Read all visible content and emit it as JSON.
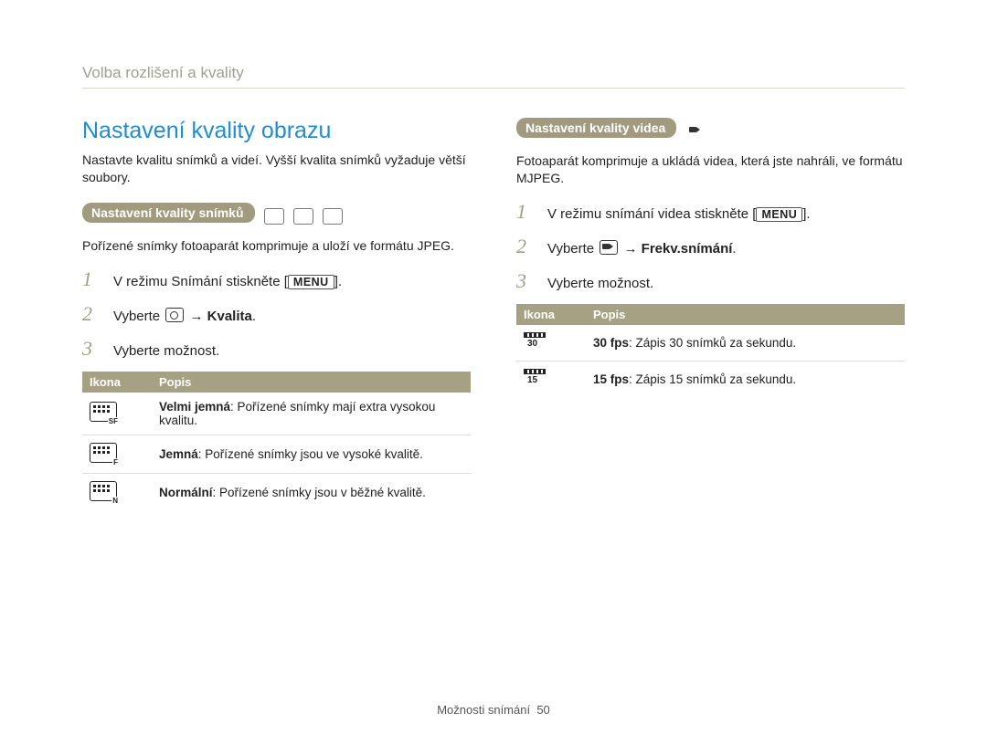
{
  "breadcrumb": "Volba rozlišení a kvality",
  "left": {
    "title": "Nastavení kvality obrazu",
    "intro": "Nastavte kvalitu snímků a videí. Vyšší kvalita snímků vyžaduje větší soubory.",
    "pill": "Nastavení kvality snímků",
    "sub": "Pořízené snímky fotoaparát komprimuje a uloží ve formátu JPEG.",
    "steps": {
      "s1_a": "V režimu Snímání stiskněte [",
      "s1_btn": "MENU",
      "s1_b": "].",
      "s2_a": "Vyberte ",
      "s2_arrow": " → ",
      "s2_bold": "Kvalita",
      "s2_b": ".",
      "s3": "Vyberte možnost."
    },
    "table": {
      "h1": "Ikona",
      "h2": "Popis",
      "rows": [
        {
          "icon_sub": "SF",
          "bold": "Velmi jemná",
          "text": ": Pořízené snímky mají extra vysokou kvalitu."
        },
        {
          "icon_sub": "F",
          "bold": "Jemná",
          "text": ": Pořízené snímky jsou ve vysoké kvalitě."
        },
        {
          "icon_sub": "N",
          "bold": "Normální",
          "text": ": Pořízené snímky jsou v běžné kvalitě."
        }
      ]
    }
  },
  "right": {
    "pill": "Nastavení kvality videa",
    "sub": "Fotoaparát komprimuje a ukládá videa, která jste nahráli, ve formátu MJPEG.",
    "steps": {
      "s1_a": "V režimu snímání videa stiskněte [",
      "s1_btn": "MENU",
      "s1_b": "].",
      "s2_a": "Vyberte ",
      "s2_arrow": " → ",
      "s2_bold": "Frekv.snímání",
      "s2_b": ".",
      "s3": "Vyberte možnost."
    },
    "table": {
      "h1": "Ikona",
      "h2": "Popis",
      "rows": [
        {
          "fps": "30",
          "bold": "30 fps",
          "text": ": Zápis 30 snímků za sekundu."
        },
        {
          "fps": "15",
          "bold": "15 fps",
          "text": ": Zápis 15 snímků za sekundu."
        }
      ]
    }
  },
  "footer": {
    "section": "Možnosti snímání",
    "page": "50"
  }
}
